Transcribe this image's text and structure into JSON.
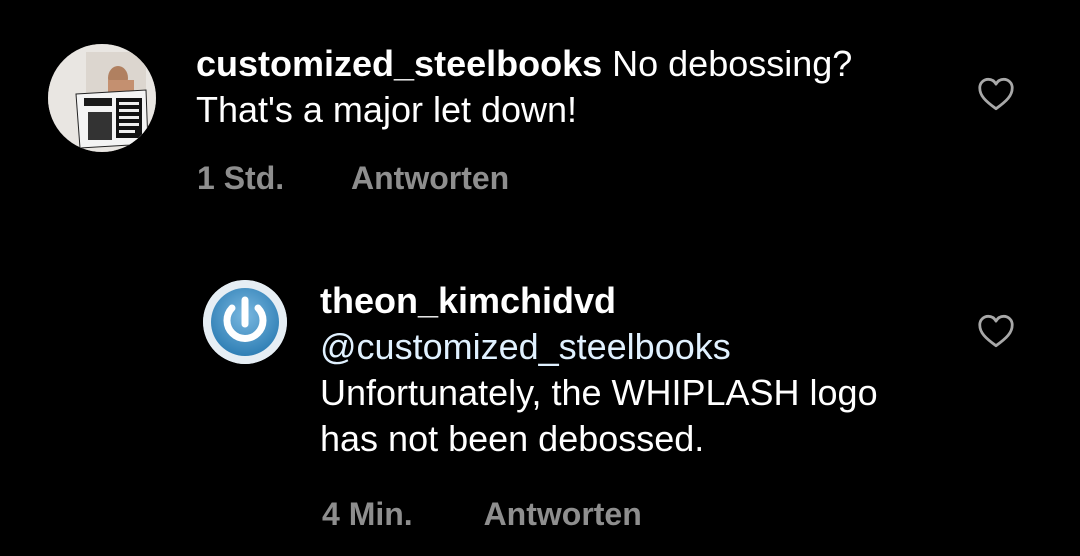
{
  "comments": [
    {
      "username": "customized_steelbooks",
      "text": "No debossing? That's a major let down!",
      "time": "1 Std.",
      "reply_label": "Antworten",
      "avatar_icon": "newspaper-photo-avatar",
      "like_icon": "heart-outline-icon"
    },
    {
      "username": "theon_kimchidvd",
      "mention": "@customized_steelbooks",
      "text": "Unfortunately, the WHIPLASH logo has not been debossed.",
      "time": "4 Min.",
      "reply_label": "Antworten",
      "avatar_icon": "power-button-avatar",
      "like_icon": "heart-outline-icon"
    }
  ],
  "colors": {
    "background": "#000000",
    "text": "#ffffff",
    "meta": "#8e8e8e",
    "mention": "#e0f1ff",
    "avatar_accent": "#3d8fc4"
  }
}
